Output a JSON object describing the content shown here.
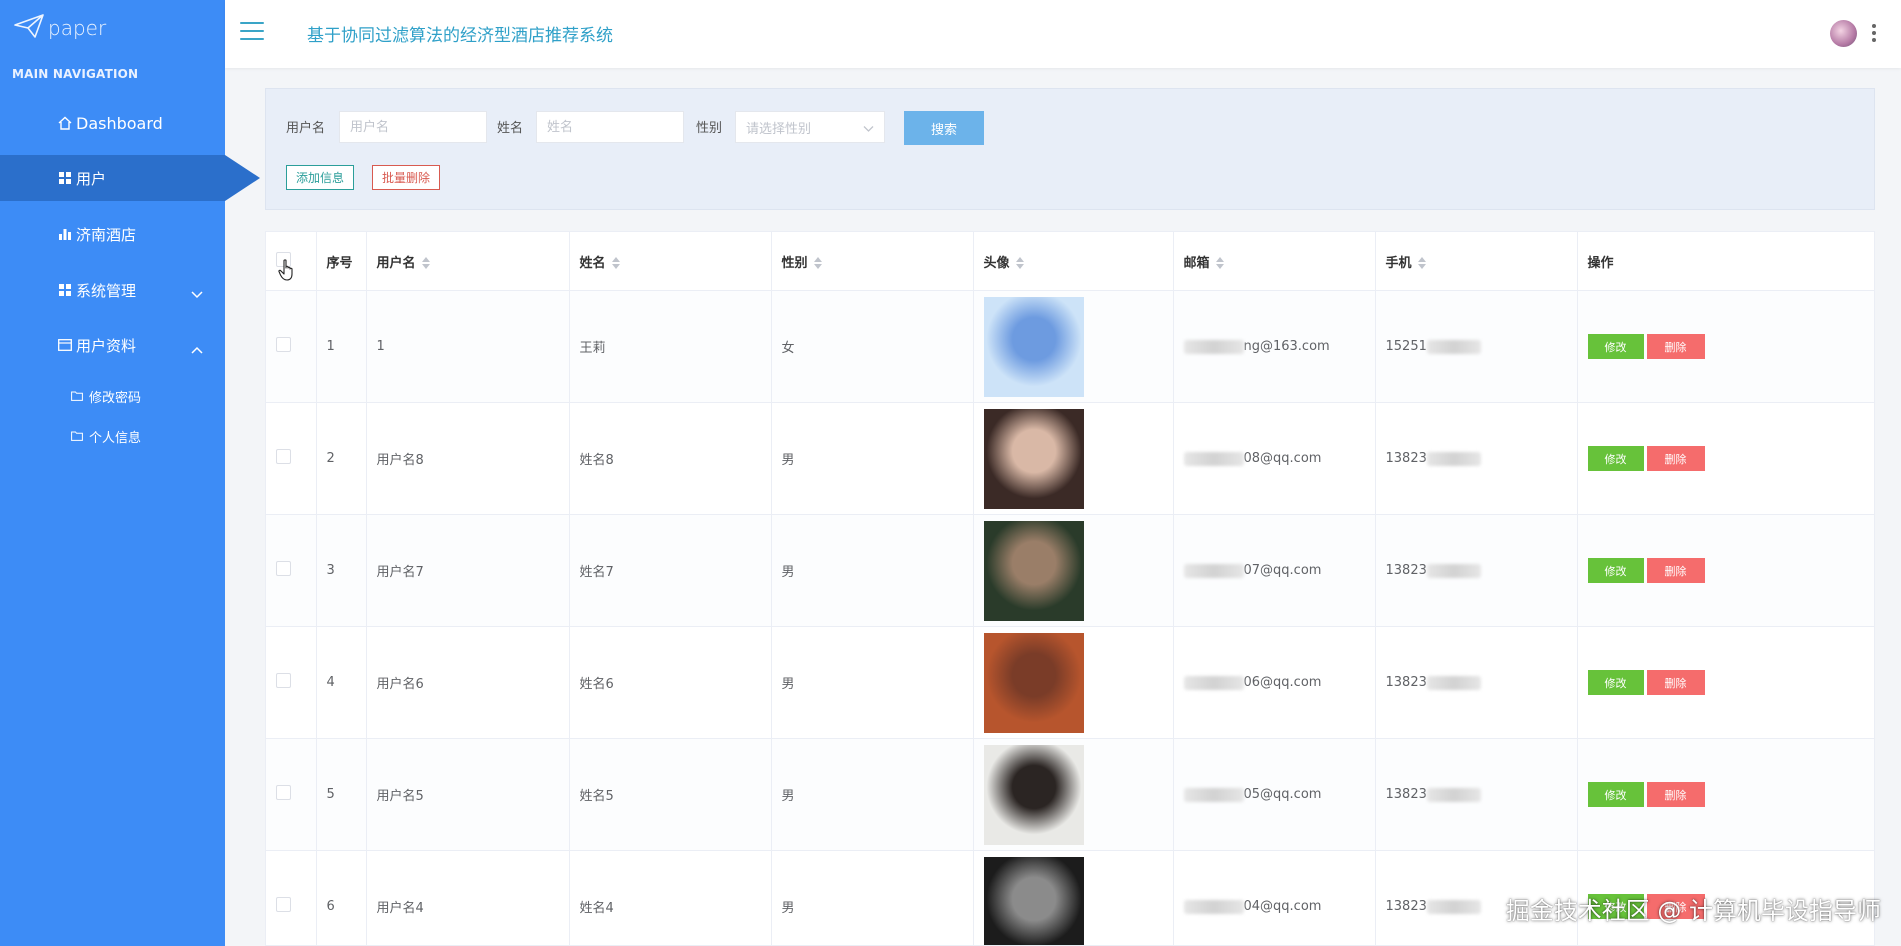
{
  "brand": {
    "name": "paper"
  },
  "sidebar": {
    "caption": "MAIN NAVIGATION",
    "items": [
      {
        "label": "Dashboard",
        "icon": "home-icon"
      },
      {
        "label": "用户",
        "icon": "grid-icon",
        "active": true
      },
      {
        "label": "济南酒店",
        "icon": "bar-chart-icon"
      },
      {
        "label": "系统管理",
        "icon": "grid-icon",
        "chevron": "down"
      },
      {
        "label": "用户资料",
        "icon": "card-icon",
        "chevron": "up"
      }
    ],
    "subitems": [
      {
        "label": "修改密码",
        "icon": "folder-icon"
      },
      {
        "label": "个人信息",
        "icon": "folder-icon"
      }
    ]
  },
  "header": {
    "title": "基于协同过滤算法的经济型酒店推荐系统"
  },
  "search": {
    "username_label": "用户名",
    "username_placeholder": "用户名",
    "name_label": "姓名",
    "name_placeholder": "姓名",
    "gender_label": "性别",
    "gender_placeholder": "请选择性别",
    "search_button": "搜索",
    "add_button": "添加信息",
    "batch_delete_button": "批量删除"
  },
  "table": {
    "columns": [
      "序号",
      "用户名",
      "姓名",
      "性别",
      "头像",
      "邮箱",
      "手机",
      "操作"
    ],
    "edit_label": "修改",
    "delete_label": "删除",
    "rows": [
      {
        "index": "1",
        "username": "1",
        "name": "王莉",
        "gender": "女",
        "email_visible": "ng@163.com",
        "phone_visible": "15251",
        "avatar_colors": [
          "#cde3f8",
          "#6d9be0"
        ]
      },
      {
        "index": "2",
        "username": "用户名8",
        "name": "姓名8",
        "gender": "男",
        "email_visible": "08@qq.com",
        "phone_visible": "13823",
        "avatar_colors": [
          "#3b2a26",
          "#d9b8a6"
        ]
      },
      {
        "index": "3",
        "username": "用户名7",
        "name": "姓名7",
        "gender": "男",
        "email_visible": "07@qq.com",
        "phone_visible": "13823",
        "avatar_colors": [
          "#2a3b2a",
          "#9a7e68"
        ]
      },
      {
        "index": "4",
        "username": "用户名6",
        "name": "姓名6",
        "gender": "男",
        "email_visible": "06@qq.com",
        "phone_visible": "13823",
        "avatar_colors": [
          "#b7552d",
          "#7a3c28"
        ]
      },
      {
        "index": "5",
        "username": "用户名5",
        "name": "姓名5",
        "gender": "男",
        "email_visible": "05@qq.com",
        "phone_visible": "13823",
        "avatar_colors": [
          "#e9e9e6",
          "#2b2523"
        ]
      },
      {
        "index": "6",
        "username": "用户名4",
        "name": "姓名4",
        "gender": "男",
        "email_visible": "04@qq.com",
        "phone_visible": "13823",
        "avatar_colors": [
          "#1c1c1c",
          "#8b8b8b"
        ]
      }
    ]
  },
  "watermark": "掘金技术社区 @ 计算机毕设指导师"
}
